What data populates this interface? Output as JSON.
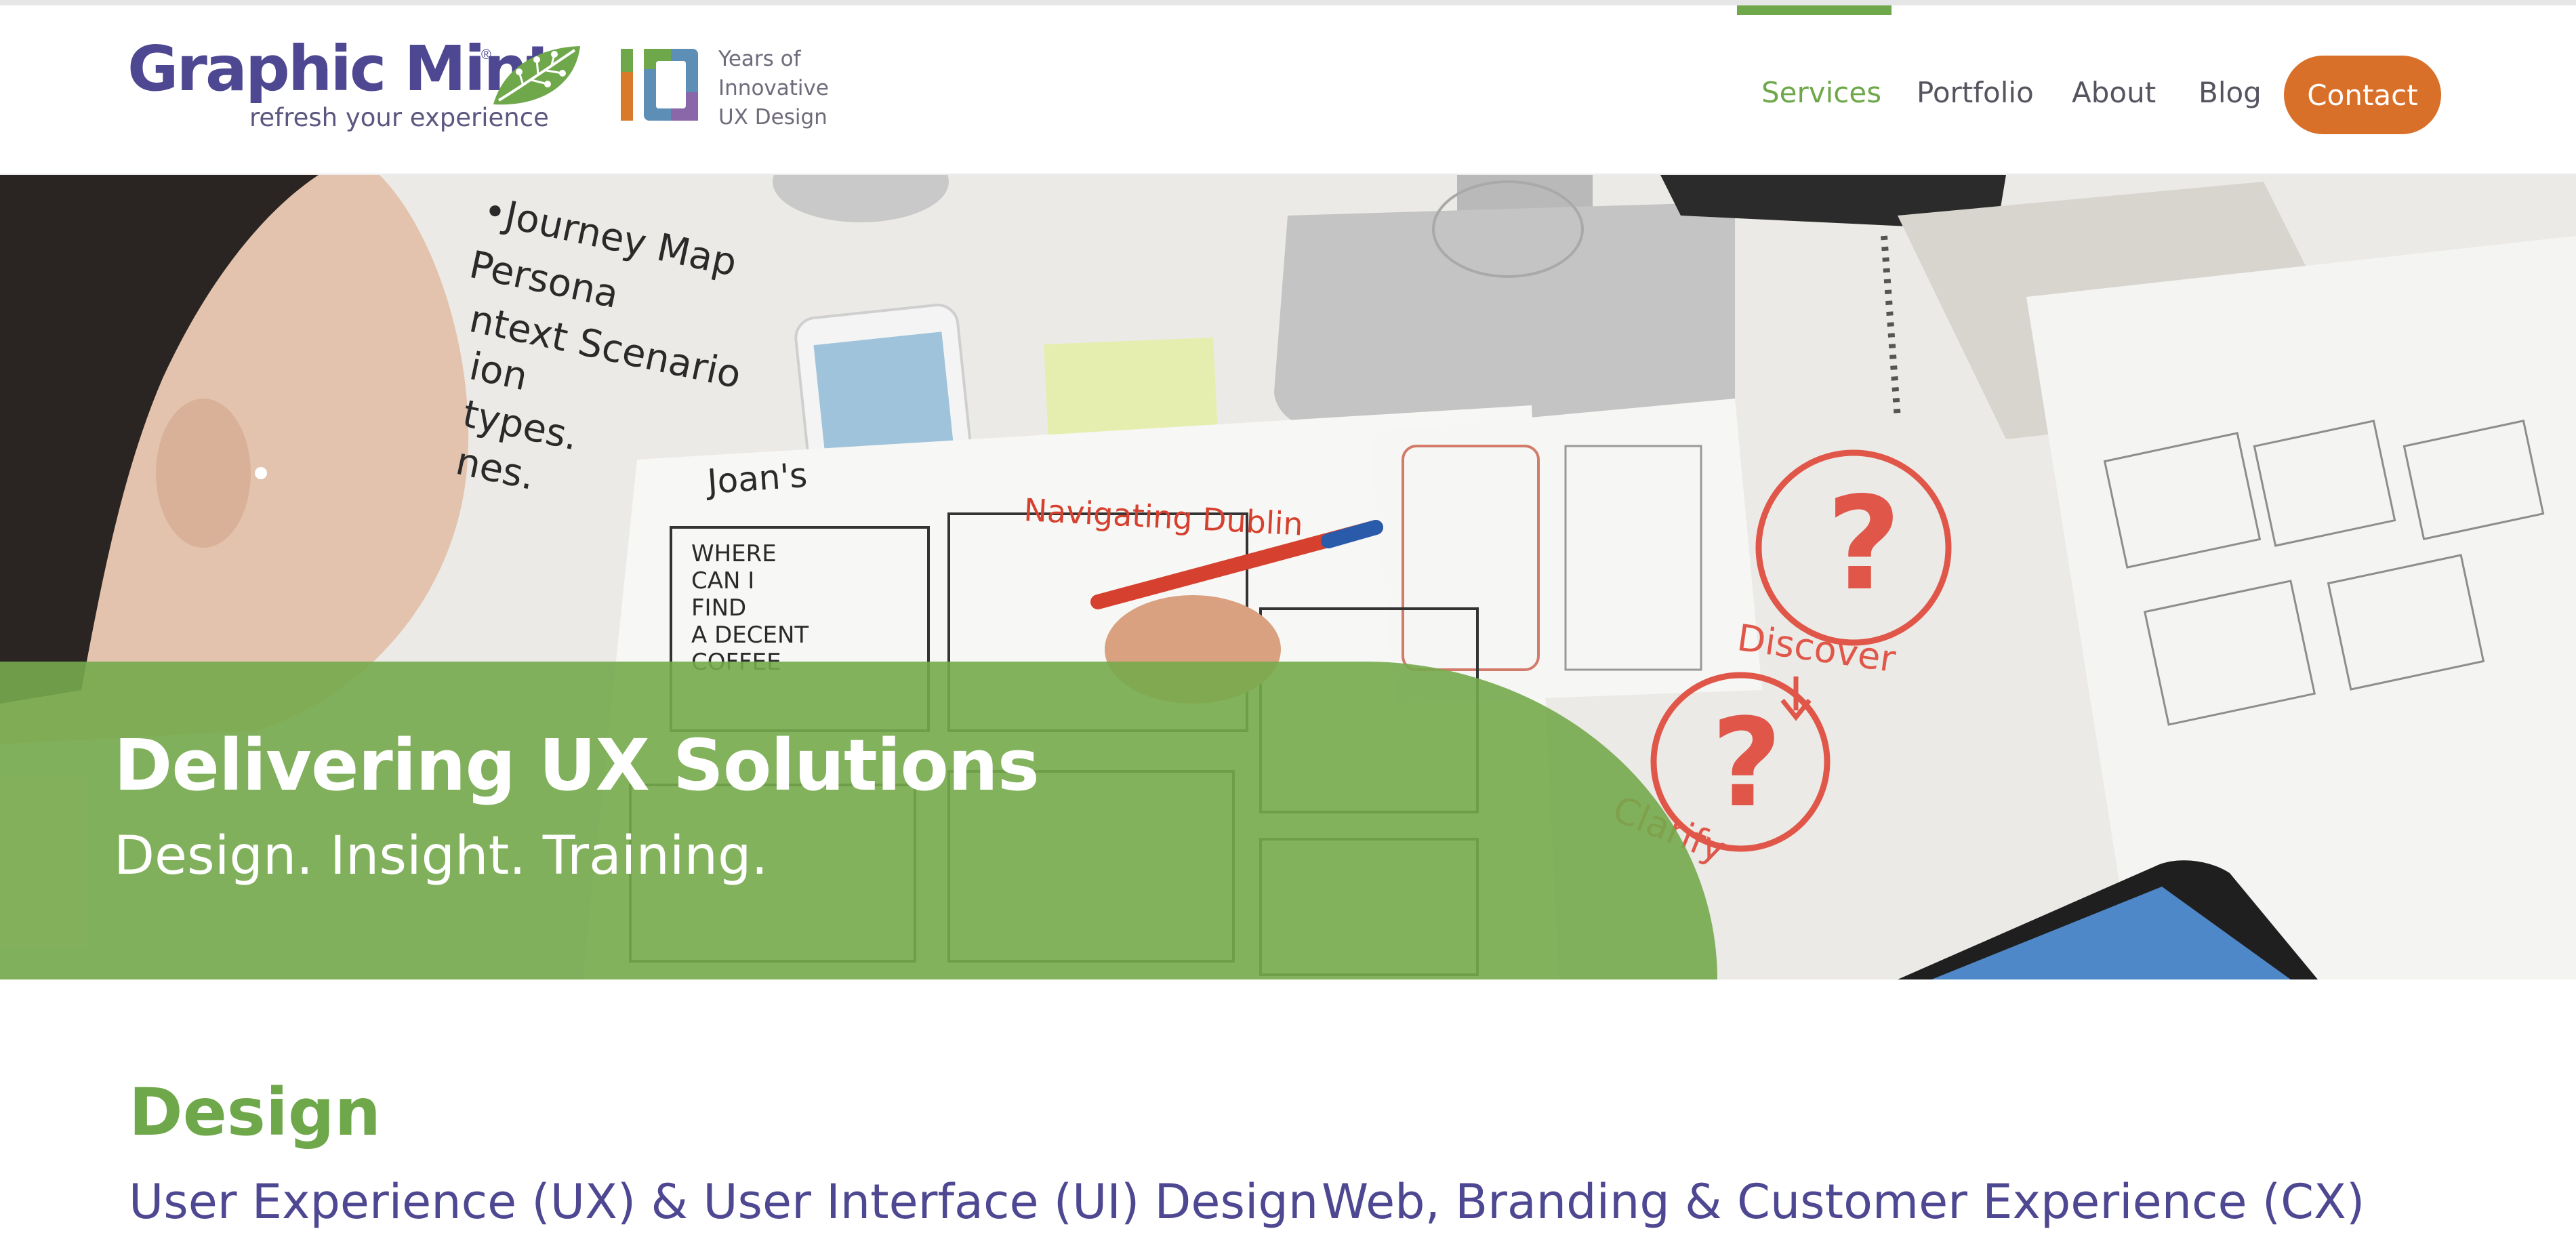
{
  "brand": {
    "name": "Graphic Mint",
    "registered_mark": "®",
    "tagline": "refresh your experience",
    "primary_color": "#4e4791",
    "leaf_color": "#6fa84b"
  },
  "anniversary": {
    "number": "10",
    "line1": "Years of",
    "line2": "Innovative",
    "line3": "UX Design"
  },
  "nav": {
    "items": [
      {
        "label": "Services",
        "active": true
      },
      {
        "label": "Portfolio",
        "active": false
      },
      {
        "label": "About",
        "active": false
      },
      {
        "label": "Blog",
        "active": false
      }
    ],
    "contact_label": "Contact",
    "active_color": "#6fa84b",
    "contact_color": "#d9702a"
  },
  "hero": {
    "title": "Delivering UX Solutions",
    "subtitle": "Design. Insight. Training.",
    "band_color": "#76aa4c",
    "sketch_notes": [
      "•Journey Map",
      "Persona",
      "ntext Scenario",
      "ion",
      "types.",
      "nes.",
      "Joan's",
      "Navigating Dublin",
      "WHERE",
      "CAN I",
      "FIND",
      "A DECENT",
      "COFFEE",
      "Discover",
      "Clarify"
    ]
  },
  "content": {
    "section_title": "Design",
    "columns": [
      {
        "heading": "User Experience (UX) & User Interface (UI) Design"
      },
      {
        "heading": "Web, Branding & Customer Experience (CX)"
      }
    ]
  }
}
